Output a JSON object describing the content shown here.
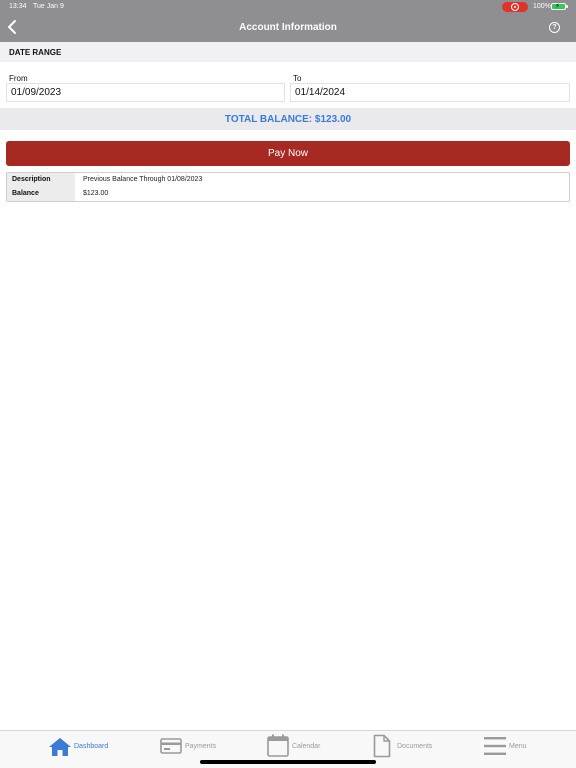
{
  "status_bar": {
    "time": "13:34",
    "date": "Tue Jan 9",
    "battery": "100%"
  },
  "nav": {
    "title": "Account Information"
  },
  "date_range": {
    "header": "DATE RANGE",
    "from_label": "From",
    "from_value": "01/09/2023",
    "to_label": "To",
    "to_value": "01/14/2024"
  },
  "total": {
    "text": "TOTAL BALANCE: $123.00"
  },
  "pay_button": {
    "label": "Pay Now"
  },
  "details": {
    "rows": [
      {
        "key": "Description",
        "value": "Previous Balance Through 01/08/2023"
      },
      {
        "key": "Balance",
        "value": "$123.00"
      }
    ]
  },
  "tabs": [
    {
      "label": "Dashboard",
      "icon": "home-icon",
      "active": true
    },
    {
      "label": "Payments",
      "icon": "credit-card-icon",
      "active": false
    },
    {
      "label": "Calendar",
      "icon": "calendar-icon",
      "active": false
    },
    {
      "label": "Documents",
      "icon": "document-icon",
      "active": false
    },
    {
      "label": "Menu",
      "icon": "hamburger-menu-icon",
      "active": false
    }
  ],
  "colors": {
    "header_gray": "#8e8e93",
    "accent_blue": "#3a7bd5",
    "pay_red": "#a72a22",
    "record_red": "#e0342a",
    "battery_green": "#34c759"
  }
}
